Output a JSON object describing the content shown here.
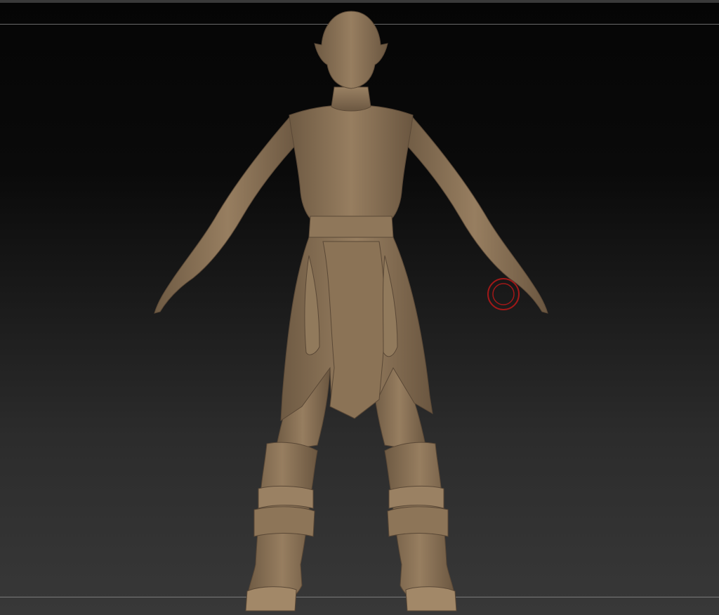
{
  "viewport": {
    "background_top": "#050505",
    "background_bottom": "#383838"
  },
  "model": {
    "skin_color": "#8c7559",
    "highlight_color": "#a38a6a",
    "shadow_color": "#5e4c38",
    "icon": "clay-character-model"
  },
  "brush_cursor": {
    "color": "#a01818",
    "icon": "brush-cursor-ring"
  }
}
